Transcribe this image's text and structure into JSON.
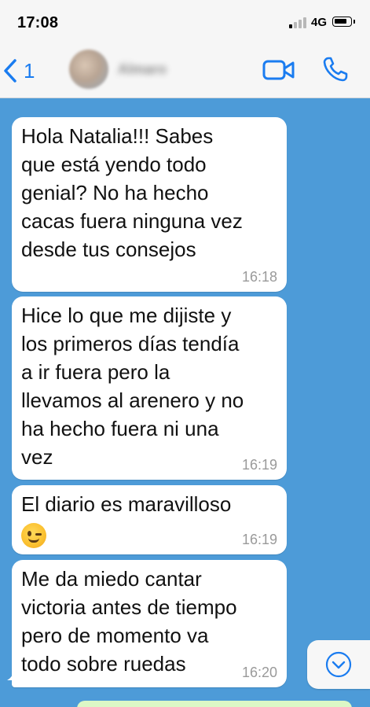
{
  "status_bar": {
    "time": "17:08",
    "network": "4G"
  },
  "header": {
    "back_count": "1",
    "contact_name": "Almaro"
  },
  "messages": [
    {
      "text": "Hola Natalia!!! Sabes\nque está yendo todo\ngenial? No ha hecho\ncacas fuera ninguna vez\ndesde tus consejos",
      "time": "16:18"
    },
    {
      "text": "Hice lo que me dijiste y\nlos primeros días tendía\na ir fuera pero la\nllevamos al arenero y no\nha hecho fuera ni una\nvez",
      "time": "16:19"
    },
    {
      "text": "El diario es maravilloso",
      "emoji": "winking-face",
      "time": "16:19"
    },
    {
      "text": "Me da miedo cantar\nvictoria antes de tiempo\npero de momento va\ntodo sobre ruedas",
      "time": "16:20"
    }
  ],
  "colors": {
    "chat_background": "#4d9bd8",
    "accent_blue": "#1a7cf0",
    "incoming_bubble": "#ffffff",
    "outgoing_bubble": "#dcf8c6"
  },
  "icons": {
    "back": "chevron-left-icon",
    "video": "video-camera-icon",
    "call": "phone-icon",
    "scroll_down": "chevron-down-circle-icon"
  }
}
